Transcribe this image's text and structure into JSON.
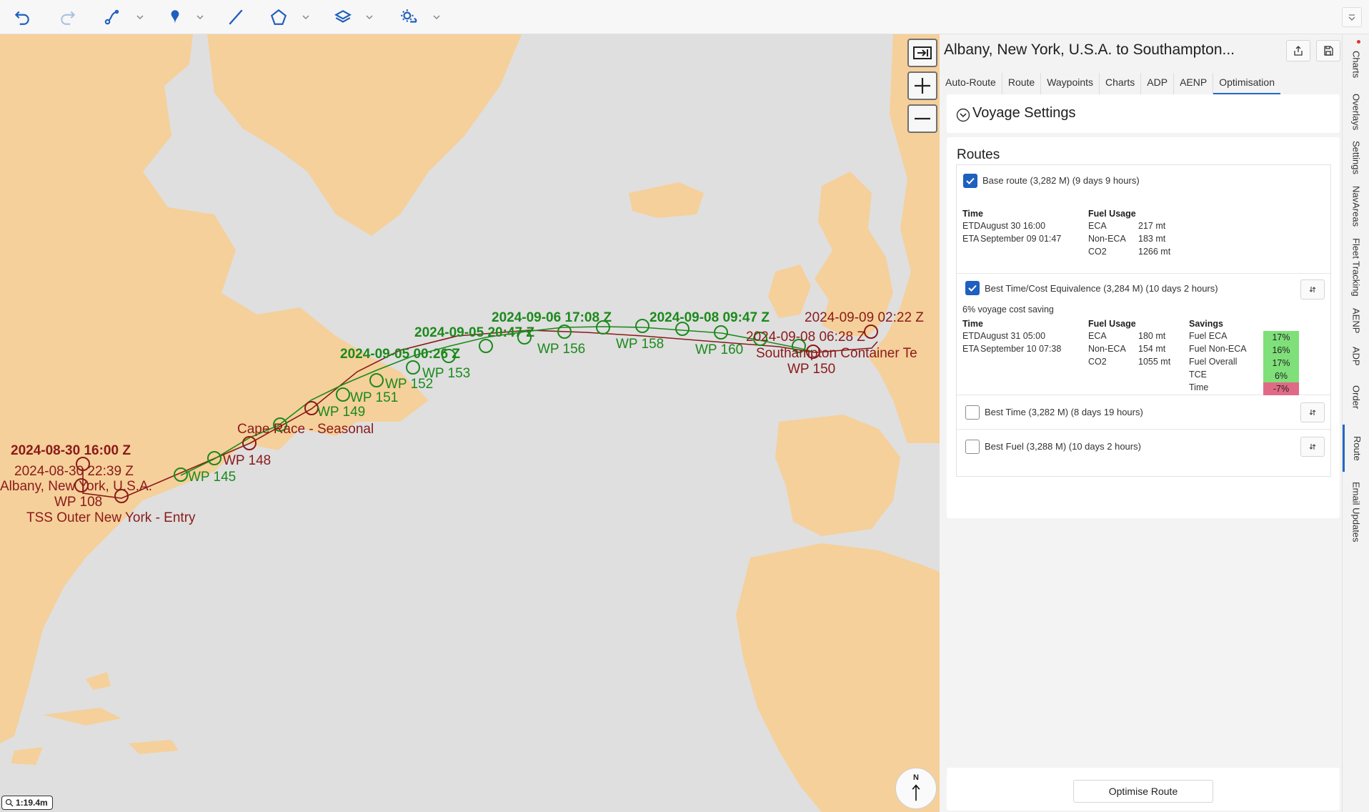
{
  "toolbar": {
    "icons": [
      "undo-icon",
      "redo-icon",
      "route-draw-icon",
      "pin-icon",
      "line-icon",
      "polygon-icon",
      "layers-icon",
      "weather-icon",
      "overflow-icon"
    ]
  },
  "map": {
    "scale_label": "1:19.4m",
    "north_label": "N",
    "labels": {
      "start_bold": "2024-08-30 16:00 Z",
      "start_red": "2024-08-30 22:39 Z",
      "origin": "Albany, New York, U.S.A.",
      "wp108": "WP 108",
      "tss": "TSS Outer New York - Entry",
      "wp145": "WP 145",
      "wp148": "WP 148",
      "cape_race": "Cape Race - Seasonal",
      "wp149": "WP 149",
      "wp151": "WP 151",
      "wp152": "WP 152",
      "wp153": "WP 153",
      "t0905a": "2024-09-05 00:26 Z",
      "t0905b": "2024-09-05 20:47 Z",
      "t0906": "2024-09-06 17:08 Z",
      "wp156": "WP 156",
      "t0908g": "2024-09-08 09:47 Z",
      "wp158": "WP 158",
      "wp160": "WP 160",
      "t0909": "2024-09-09 02:22 Z",
      "t0908r": "2024-09-08 06:28 Z",
      "southampton": "Southampton Container Te",
      "wp150": "WP 150"
    },
    "colors": {
      "land": "#f5d09a",
      "water": "#dedede",
      "green": "#1b8a1b",
      "red": "#8b1a1a"
    }
  },
  "panel": {
    "title": "Albany, New York, U.S.A. to Southampton...",
    "tabs": [
      "Auto-Route",
      "Route",
      "Waypoints",
      "Charts",
      "ADP",
      "AENP",
      "Optimisation"
    ],
    "active_tab": "Optimisation",
    "voyage_settings": "Voyage Settings",
    "routes_header": "Routes",
    "base": {
      "label": "Base route (3,282 M) (9 days 9 hours)",
      "checked": true,
      "time_h": "Time",
      "fuel_h": "Fuel Usage",
      "etd": "ETD",
      "etd_v": "August 30 16:00",
      "eta": "ETA",
      "eta_v": "September 09 01:47",
      "eca": "ECA",
      "eca_v": "217 mt",
      "neca": "Non-ECA",
      "neca_v": "183 mt",
      "co2": "CO2",
      "co2_v": "1266 mt"
    },
    "best_tce": {
      "label": "Best Time/Cost Equivalence (3,284 M) (10 days 2 hours)",
      "checked": true,
      "saving": "6% voyage cost saving",
      "time_h": "Time",
      "fuel_h": "Fuel Usage",
      "sav_h": "Savings",
      "etd": "ETD",
      "etd_v": "August 31 05:00",
      "eta": "ETA",
      "eta_v": "September 10 07:38",
      "eca": "ECA",
      "eca_v": "180 mt",
      "neca": "Non-ECA",
      "neca_v": "154 mt",
      "co2": "CO2",
      "co2_v": "1055 mt",
      "s1": "Fuel ECA",
      "s1_v": "17%",
      "s2": "Fuel Non-ECA",
      "s2_v": "16%",
      "s3": "Fuel Overall",
      "s3_v": "17%",
      "s4": "TCE",
      "s4_v": "6%",
      "s5": "Time",
      "s5_v": "-7%"
    },
    "best_time": {
      "label": "Best Time (3,282 M) (8 days 19 hours)",
      "checked": false
    },
    "best_fuel": {
      "label": "Best Fuel (3,288 M) (10 days 2 hours)",
      "checked": false
    },
    "optimise_button": "Optimise Route"
  },
  "vnav": {
    "items": [
      "Charts",
      "Overlays",
      "Settings",
      "NavAreas",
      "Fleet Tracking",
      "AENP",
      "ADP",
      "Order",
      "Route",
      "Email Updates"
    ],
    "active": "Route"
  }
}
